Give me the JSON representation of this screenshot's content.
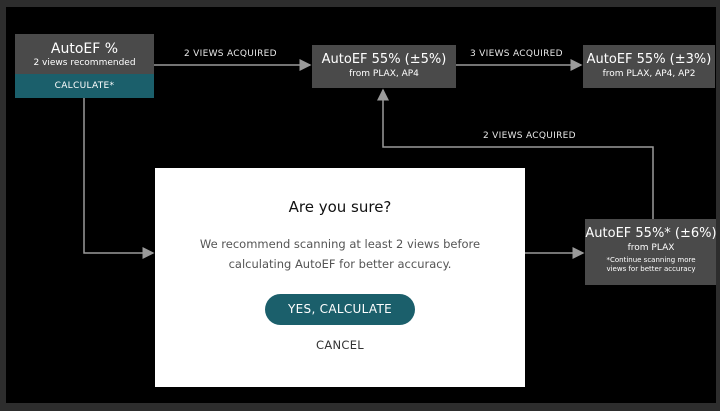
{
  "nodes": {
    "start": {
      "title": "AutoEF %",
      "subtitle": "2 views recommended",
      "button": "CALCULATE*"
    },
    "two_views": {
      "title": "AutoEF 55% (±5%)",
      "subtitle": "from PLAX, AP4"
    },
    "three_views": {
      "title": "AutoEF 55% (±3%)",
      "subtitle": "from PLAX, AP4, AP2"
    },
    "one_view": {
      "title": "AutoEF 55%* (±6%)",
      "subtitle": "from PLAX",
      "note_line1": "*Continue scanning more",
      "note_line2": "views for better accuracy"
    }
  },
  "edges": {
    "start_to_two": "2 VIEWS ACQUIRED",
    "two_to_three": "3 VIEWS ACQUIRED",
    "one_to_two": "2 VIEWS ACQUIRED"
  },
  "modal": {
    "title": "Are you sure?",
    "message_line1": "We recommend scanning at least 2 views before",
    "message_line2": "calculating AutoEF for better accuracy.",
    "confirm": "YES, CALCULATE",
    "cancel": "CANCEL"
  },
  "colors": {
    "accent": "#1b5f6b",
    "node": "#4a4a4a",
    "background": "#000000",
    "connector": "#9a9a9a"
  }
}
